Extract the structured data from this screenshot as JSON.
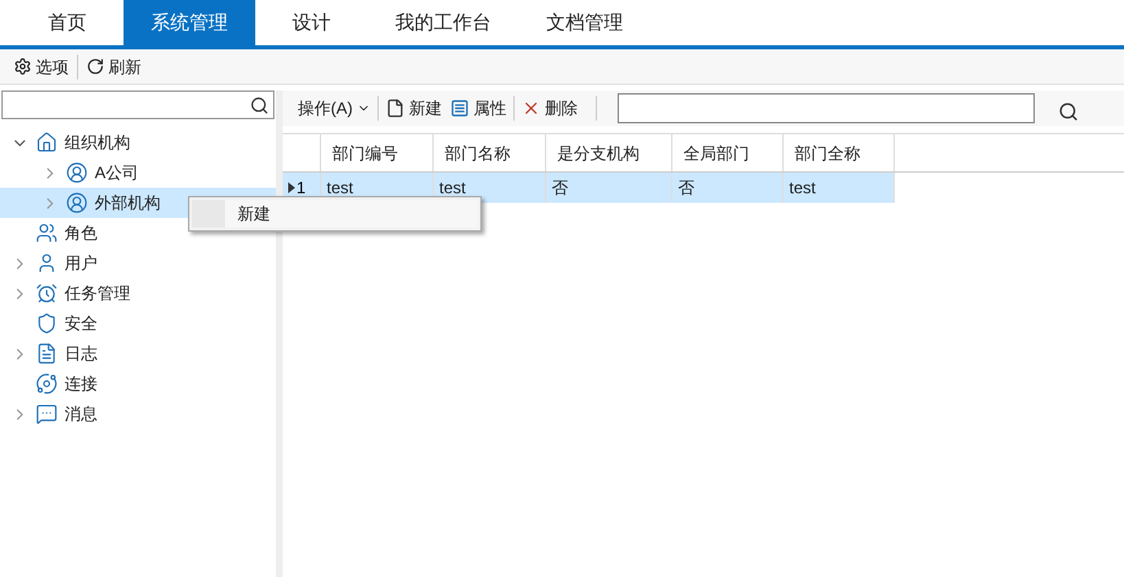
{
  "tabs": [
    {
      "label": "首页",
      "selected": false
    },
    {
      "label": "系统管理",
      "selected": true
    },
    {
      "label": "设计",
      "selected": false
    },
    {
      "label": "我的工作台",
      "selected": false
    },
    {
      "label": "文档管理",
      "selected": false
    }
  ],
  "toolbar": [
    {
      "label": "选项"
    },
    {
      "label": "刷新"
    }
  ],
  "tree": [
    {
      "label": "组织机构",
      "kind": "branch",
      "expanded": true,
      "selected": false,
      "children": [
        {
          "label": "A公司",
          "kind": "branch",
          "expanded": false,
          "selected": false
        },
        {
          "label": "外部机构",
          "kind": "branch",
          "expanded": false,
          "selected": true
        }
      ]
    },
    {
      "label": "角色",
      "kind": "leaf",
      "selected": false
    },
    {
      "label": "用户",
      "kind": "branch",
      "expanded": false,
      "selected": false
    },
    {
      "label": "任务管理",
      "kind": "branch",
      "expanded": false,
      "selected": false
    },
    {
      "label": "安全",
      "kind": "leaf",
      "selected": false
    },
    {
      "label": "日志",
      "kind": "branch",
      "expanded": false,
      "selected": false
    },
    {
      "label": "连接",
      "kind": "leaf",
      "selected": false
    },
    {
      "label": "消息",
      "kind": "branch",
      "expanded": false,
      "selected": false
    }
  ],
  "grid_toolbar": [
    {
      "label": "操作(A)",
      "kind": "menu"
    },
    {
      "label": "新建",
      "kind": "new"
    },
    {
      "label": "属性",
      "kind": "properties"
    },
    {
      "label": "删除",
      "kind": "delete"
    }
  ],
  "table": {
    "columns": [
      "部门编号",
      "部门名称",
      "是分支机构",
      "全局部门",
      "部门全称"
    ],
    "rows": [
      {
        "number": "1",
        "selected": true,
        "cells": [
          "test",
          "test",
          "否",
          "否",
          "test"
        ]
      }
    ]
  },
  "context_menu": {
    "items": [
      "新建"
    ]
  }
}
